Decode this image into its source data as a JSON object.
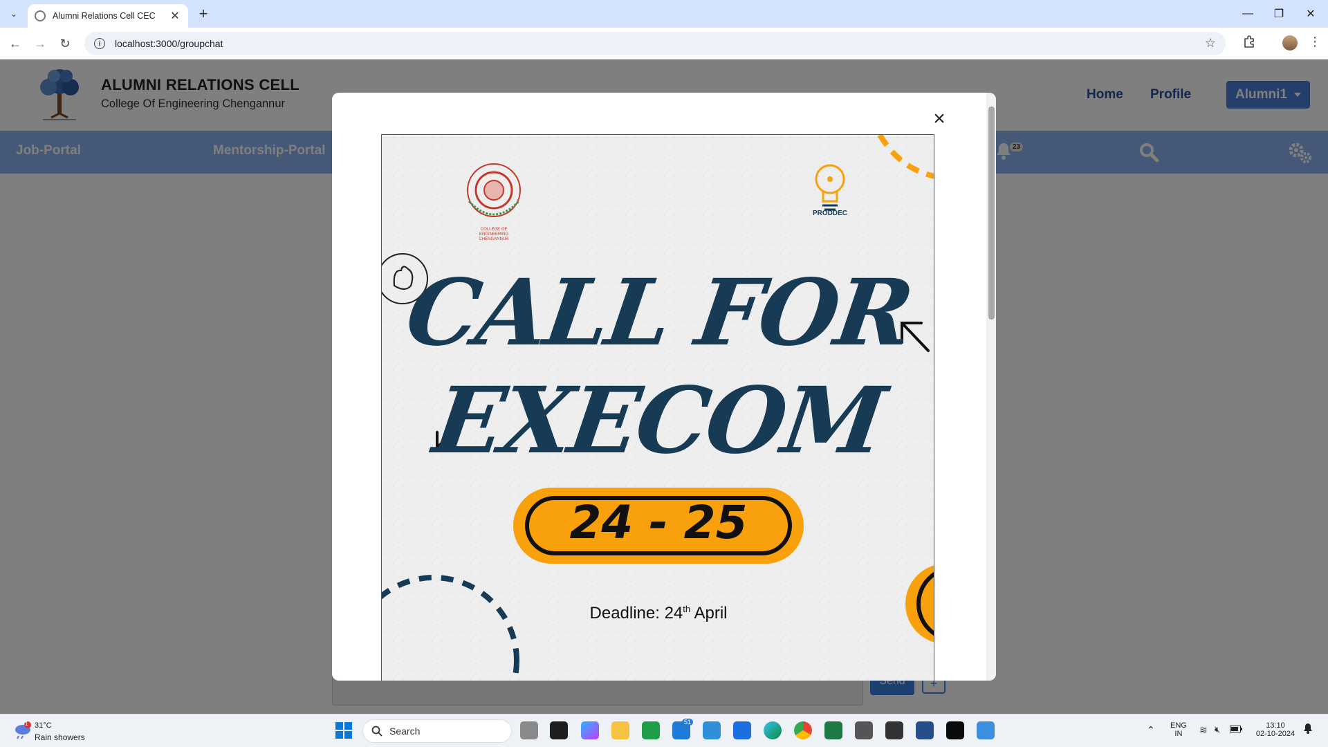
{
  "browser": {
    "tab_title": "Alumni Relations Cell CEC",
    "tab_close": "✕",
    "new_tab": "+",
    "url": "localhost:3000/groupchat",
    "back": "←",
    "forward": "→",
    "reload": "↻",
    "star": "☆",
    "menu": "⋮",
    "win_min": "—",
    "win_restore": "❐",
    "win_close": "✕"
  },
  "site": {
    "title": "ALUMNI RELATIONS CELL",
    "subtitle": "College Of Engineering Chengannur",
    "links": {
      "home": "Home",
      "profile": "Profile"
    },
    "user_button": "Alumni1",
    "brand_color": "#8cb0f0",
    "accent_color": "#4a7ed6"
  },
  "navbar": {
    "items": [
      {
        "label": "Job-Portal"
      },
      {
        "label": "Mentorship-Portal"
      }
    ],
    "notification_count": "23",
    "icons": [
      "bell-icon",
      "search-icon",
      "gears-icon"
    ]
  },
  "chat": {
    "send_label": "Send",
    "attach_label": "+"
  },
  "modal": {
    "close_label": "×",
    "poster": {
      "headline_line1": "CALL FOR",
      "headline_line2": "EXECOM",
      "year_range": "24 - 25",
      "deadline_prefix": "Deadline: 24",
      "deadline_sup": "th",
      "deadline_suffix": " April",
      "proddec_label": "PRODDEC",
      "seal_text": "COLLEGE OF ENGINEERING CHENGANNUR",
      "accent_color": "#f8a10d",
      "text_color": "#173a55"
    }
  },
  "taskbar": {
    "weather_temp": "31°C",
    "weather_desc": "Rain showers",
    "weather_badge": "1",
    "search_placeholder": "Search",
    "mail_badge": "51",
    "lang_line1": "ENG",
    "lang_line2": "IN",
    "time": "13:10",
    "date": "02-10-2024"
  }
}
